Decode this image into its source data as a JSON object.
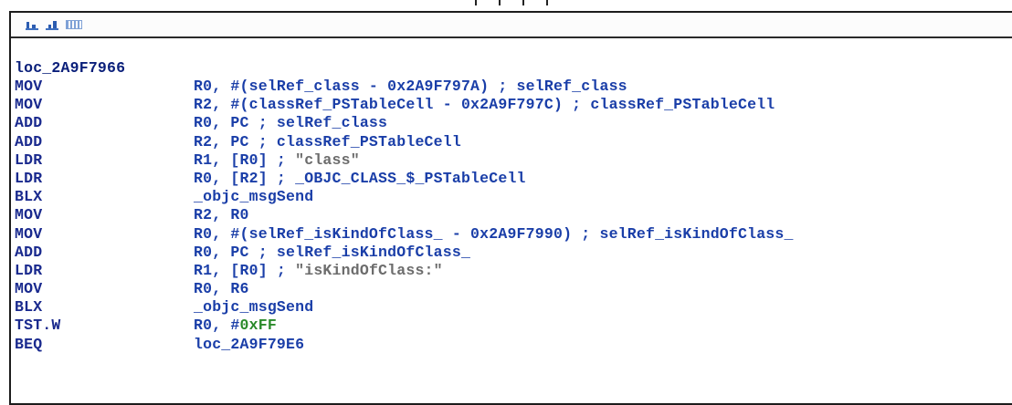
{
  "loc_label": "loc_2A9F7966",
  "rows": [
    {
      "mn": "MOV",
      "op": "R0, #(selRef_class - 0x2A9F797A) ; selRef_class",
      "cm": ""
    },
    {
      "mn": "MOV",
      "op": "R2, #(classRef_PSTableCell - 0x2A9F797C) ; classRef_PSTableCell",
      "cm": ""
    },
    {
      "mn": "ADD",
      "op": "R0, PC ; selRef_class",
      "cm": ""
    },
    {
      "mn": "ADD",
      "op": "R2, PC ; classRef_PSTableCell",
      "cm": ""
    },
    {
      "mn": "LDR",
      "op": "R1, [R0] ; ",
      "cm": "\"class\""
    },
    {
      "mn": "LDR",
      "op": "R0, [R2] ; _OBJC_CLASS_$_PSTableCell",
      "cm": ""
    },
    {
      "mn": "BLX",
      "op": "_objc_msgSend",
      "cm": ""
    },
    {
      "mn": "MOV",
      "op": "R2, R0",
      "cm": ""
    },
    {
      "mn": "MOV",
      "op": "R0, #(selRef_isKindOfClass_ - 0x2A9F7990) ; selRef_isKindOfClass_",
      "cm": ""
    },
    {
      "mn": "ADD",
      "op": "R0, PC ; selRef_isKindOfClass_",
      "cm": ""
    },
    {
      "mn": "LDR",
      "op": "R1, [R0] ; ",
      "cm": "\"isKindOfClass:\""
    },
    {
      "mn": "MOV",
      "op": "R0, R6",
      "cm": ""
    },
    {
      "mn": "BLX",
      "op": "_objc_msgSend",
      "cm": ""
    },
    {
      "mn": "TST.W",
      "op": "R0, #",
      "cm": "",
      "num": "0xFF"
    },
    {
      "mn": "BEQ",
      "op": "loc_2A9F79E6",
      "cm": ""
    }
  ],
  "colors": {
    "mnemonic": "#1a2a8e",
    "operand": "#1a3ea8",
    "comment": "#6c6c6c",
    "immediate": "#2a8a2a"
  },
  "icons": [
    "graph-icon",
    "graph-zoom-icon",
    "overview-icon"
  ]
}
